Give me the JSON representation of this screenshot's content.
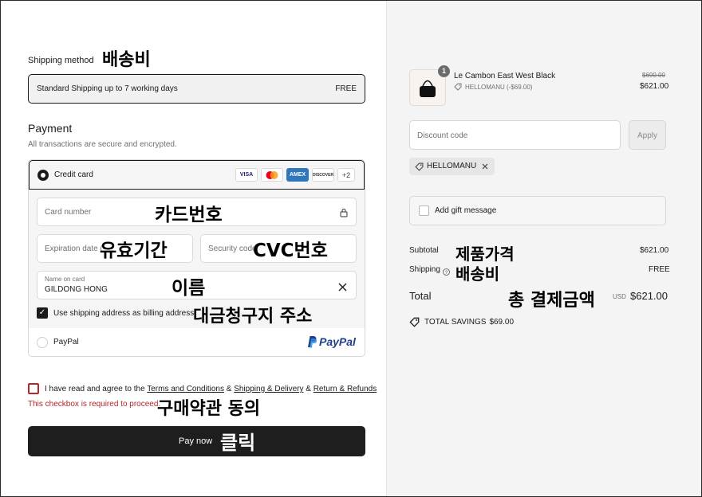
{
  "shipping": {
    "label": "Shipping method",
    "annotation": "배송비",
    "option_name": "Standard Shipping up to 7 working days",
    "option_price": "FREE"
  },
  "payment": {
    "title": "Payment",
    "subtitle": "All transactions are secure and encrypted.",
    "credit_card_label": "Credit card",
    "card_brands": [
      "VISA",
      "Mastercard",
      "AMEX",
      "DISCOVER"
    ],
    "more_brands": "+2",
    "card_number_placeholder": "Card number",
    "card_number_annotation": "카드번호",
    "expiration_placeholder": "Expiration date (",
    "expiration_annotation": "유효기간",
    "security_placeholder": "Security code",
    "security_annotation": "CVC번호",
    "name_label": "Name on card",
    "name_value": "GILDONG HONG",
    "name_annotation": "이름",
    "billing_checkbox_label": "Use shipping address as billing address",
    "billing_annotation": "대금청구지 주소",
    "paypal_label": "PayPal",
    "paypal_logo_text": "PayPal"
  },
  "terms": {
    "prefix": "I have read and agree to the ",
    "terms_link": "Terms and Conditions",
    "sep1": " & ",
    "shipping_link": "Shipping & Delivery",
    "sep2": " & ",
    "refund_link": "Return & Refunds",
    "error": "This checkbox is required to proceed.",
    "annotation": "구매약관 동의"
  },
  "pay_button": {
    "label": "Pay now",
    "annotation": "클릭"
  },
  "order": {
    "item": {
      "quantity": "1",
      "name": "Le Cambon East West Black",
      "discount_line": "HELLOMANU (-$69.00)",
      "original_price": "$690.00",
      "price": "$621.00"
    },
    "discount": {
      "placeholder": "Discount code",
      "apply_label": "Apply",
      "applied_code": "HELLOMANU"
    },
    "gift_label": "Add gift message",
    "subtotal_label": "Subtotal",
    "subtotal_annotation": "제품가격",
    "subtotal_value": "$621.00",
    "shipping_label": "Shipping",
    "shipping_annotation": "배송비",
    "shipping_value": "FREE",
    "total_label": "Total",
    "total_annotation": "총 결제금액",
    "total_currency": "USD",
    "total_value": "$621.00",
    "savings_label": "TOTAL SAVINGS",
    "savings_value": "$69.00"
  },
  "colors": {
    "dark": "#1e1e1e",
    "error_red": "#b3262d",
    "panel_gray": "#f4f4f4",
    "paypal_blue": "#1e3f8a",
    "amex_blue": "#2e77bc",
    "discover_orange": "#e8751a"
  }
}
